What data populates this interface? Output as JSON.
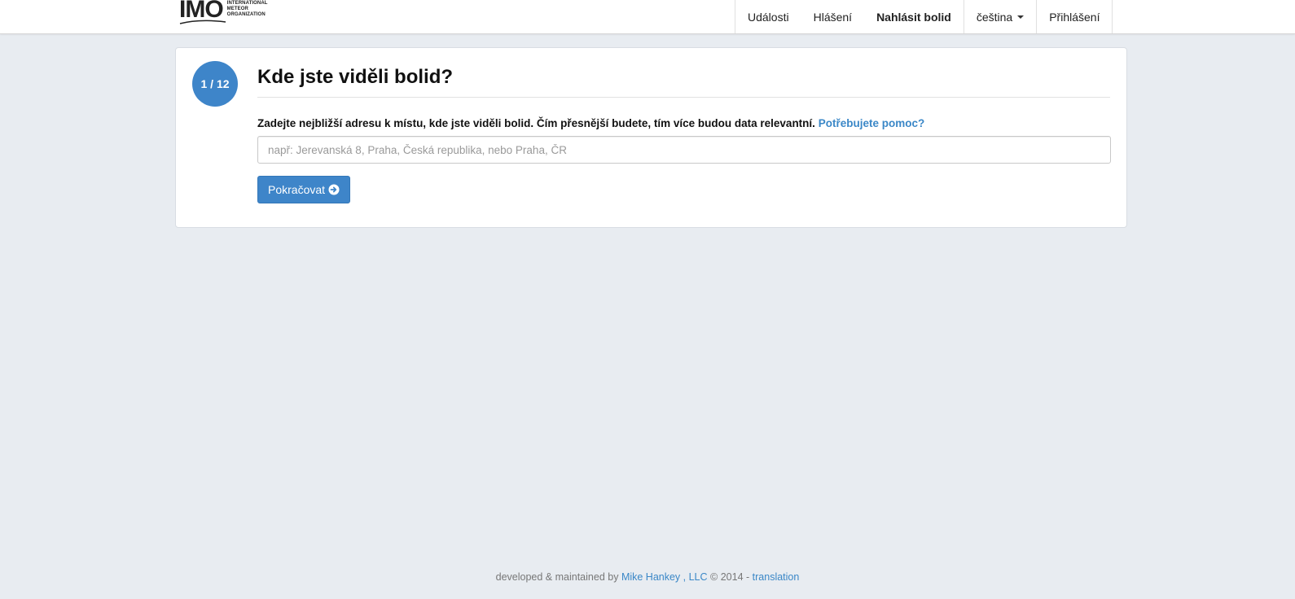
{
  "logo": {
    "mark": "IMO",
    "sub_lines": [
      "INTERNATIONAL",
      "METEOR",
      "ORGANIZATION"
    ]
  },
  "nav": {
    "items": [
      {
        "label": "Události"
      },
      {
        "label": "Hlášení"
      },
      {
        "label": "Nahlásit bolid"
      },
      {
        "label": "čeština"
      },
      {
        "label": "Přihlášení"
      }
    ]
  },
  "step": {
    "badge": "1 / 12",
    "title": "Kde jste viděli bolid?",
    "instruction": "Zadejte nejbližší adresu k místu, kde jste viděli bolid. Čím přesnější budete, tím více budou data relevantní.",
    "help_link": "Potřebujete pomoc?",
    "input_placeholder": "např: Jerevanská 8, Praha, Česká republika, nebo Praha, ČR",
    "input_value": "",
    "continue_label": "Pokračovat"
  },
  "footer": {
    "prefix": "developed & maintained by",
    "author": "Mike Hankey , LLC",
    "copyright": "© 2014 -",
    "translation": "translation"
  },
  "colors": {
    "accent": "#3e85c9",
    "link": "#3a87c7",
    "background": "#e8ecf1"
  }
}
